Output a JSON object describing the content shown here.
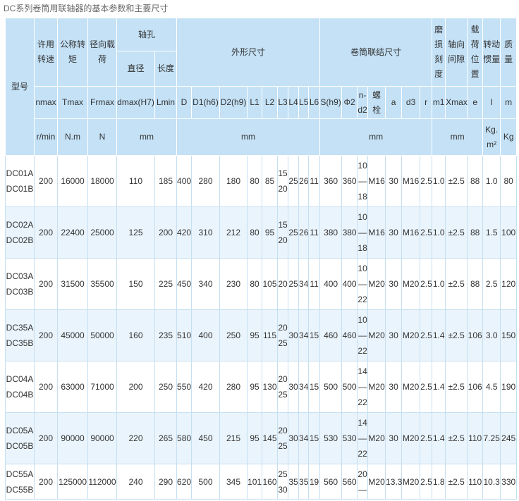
{
  "page_title": "DC系列卷筒用联轴器的基本参数和主要尺寸",
  "colors": {
    "header_bg": "#c4e1f6",
    "row_bg": "#ffffff",
    "row_alt_bg": "#eaf4fc",
    "grid_line": "#c6dff1",
    "header_grid_line": "#ffffff",
    "text": "#333333",
    "title_text": "#666666"
  },
  "table": {
    "header": {
      "model": "型号",
      "speed": "许用\n转速",
      "torque": "公称转\n矩",
      "radial_load": "径向载\n荷",
      "bore": "轴孔",
      "bore_diameter": "直径",
      "bore_length": "长度",
      "outline": "外形尺寸",
      "drum_connection": "卷筒联结尺寸",
      "wear_scale": "磨\n损\n刻\n度",
      "axial_clearance": "轴向\n间隙",
      "load_position": "载\n荷\n位\n置",
      "inertia": "转动\n惯量",
      "mass": "质\n量"
    },
    "symbols": [
      "nmax",
      "Tmax",
      "Frmax",
      "dmax(H7)",
      "Lmin",
      "D",
      "D1(h6)",
      "D2(h9)",
      "L1",
      "L2",
      "L3",
      "L4",
      "L5",
      "L6",
      "S(h9)",
      "Φ2",
      "n-\nd2",
      "螺\n栓",
      "a",
      "d3",
      "r",
      "m1",
      "Xmax",
      "e",
      "I",
      "m"
    ],
    "units": {
      "speed": "r/min",
      "torque": "N.m",
      "radial_load": "N",
      "bore": "mm",
      "outline": "mm",
      "drum_connection": "mm",
      "clearance_position": "mm",
      "inertia": "Kg.\nm²",
      "mass": "Kg"
    },
    "rows": [
      {
        "model": "DC01A\nDC01B",
        "values": [
          "200",
          "16000",
          "18000",
          "110",
          "185",
          "400",
          "280",
          "180",
          "80",
          "85",
          "15\n20",
          "25",
          "26",
          "11",
          "360",
          "360",
          "10\n—\n18",
          "M16",
          "30",
          "M16",
          "2.5",
          "1.0",
          "±2.5",
          "88",
          "1.0",
          "80"
        ]
      },
      {
        "model": "DC02A\nDC02B",
        "values": [
          "200",
          "22400",
          "25000",
          "125",
          "200",
          "420",
          "310",
          "212",
          "80",
          "95",
          "15\n20",
          "25",
          "26",
          "11",
          "380",
          "380",
          "10\n—\n18",
          "M16",
          "30",
          "M16",
          "2.5",
          "1.0",
          "±2.5",
          "88",
          "1.5",
          "100"
        ]
      },
      {
        "model": "DC03A\nDC03B",
        "values": [
          "200",
          "31500",
          "35500",
          "150",
          "225",
          "450",
          "340",
          "230",
          "80",
          "105",
          "20",
          "25",
          "34",
          "11",
          "400",
          "400",
          "10\n—\n22",
          "M20",
          "30",
          "M20",
          "2.5",
          "1.0",
          "±2.5",
          "88",
          "2.5",
          "120"
        ]
      },
      {
        "model": "DC35A\nDC35B",
        "values": [
          "200",
          "45000",
          "50000",
          "160",
          "235",
          "510",
          "400",
          "250",
          "95",
          "115",
          "20\n25",
          "30",
          "34",
          "15",
          "460",
          "460",
          "10\n—\n22",
          "M20",
          "30",
          "M20",
          "2.5",
          "1.4",
          "±2.5",
          "106",
          "3.0",
          "150"
        ]
      },
      {
        "model": "DC04A\nDC04B",
        "values": [
          "200",
          "63000",
          "71000",
          "200",
          "250",
          "550",
          "420",
          "280",
          "95",
          "130",
          "20\n25",
          "30",
          "34",
          "15",
          "500",
          "500",
          "14\n—\n22",
          "M20",
          "30",
          "M20",
          "2.5",
          "1.4",
          "±2.5",
          "106",
          "4.5",
          "190"
        ]
      },
      {
        "model": "DC05A\nDC05B",
        "values": [
          "200",
          "90000",
          "90000",
          "220",
          "265",
          "580",
          "450",
          "215",
          "95",
          "145",
          "20\n25",
          "30",
          "34",
          "15",
          "530",
          "530",
          "14\n—\n22",
          "M20",
          "30",
          "M20",
          "2.5",
          "1.4",
          "±2.5",
          "110",
          "7.25",
          "245"
        ]
      },
      {
        "model": "DC55A\nDC55B",
        "values": [
          "200",
          "125000",
          "112000",
          "240",
          "290",
          "620",
          "500",
          "345",
          "101",
          "160",
          "25\n30",
          "35",
          "35",
          "19",
          "560",
          "560",
          "20\n—",
          "M20",
          "13.3",
          "M20",
          "2.5",
          "1.8",
          "±2.5",
          "110",
          "10.3",
          "330"
        ]
      }
    ]
  }
}
